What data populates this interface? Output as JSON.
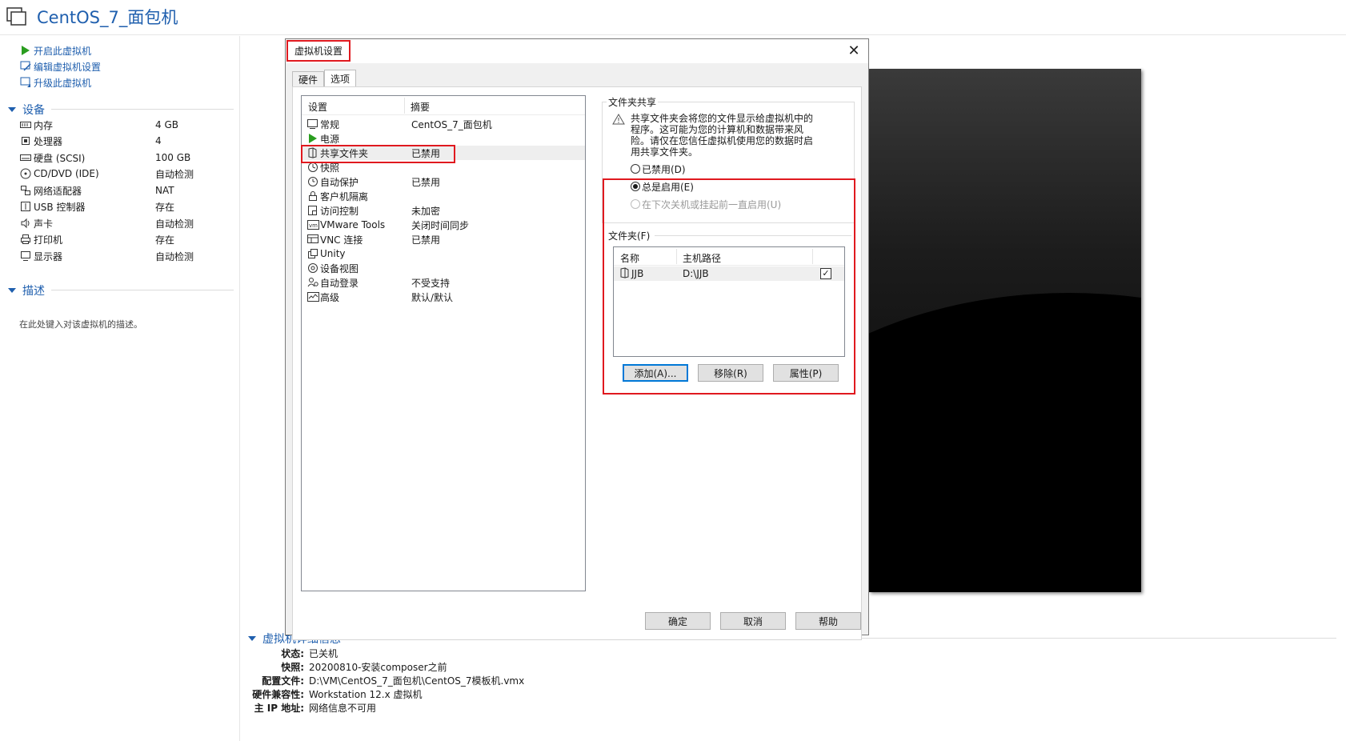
{
  "window": {
    "title": "CentOS_7_面包机"
  },
  "commands": [
    {
      "label": "开启此虚拟机",
      "icon": "play-icon"
    },
    {
      "label": "编辑虚拟机设置",
      "icon": "edit-settings-icon"
    },
    {
      "label": "升级此虚拟机",
      "icon": "upgrade-icon"
    }
  ],
  "devices": {
    "heading": "设备",
    "items": [
      {
        "name": "内存",
        "value": "4 GB",
        "icon": "memory-icon"
      },
      {
        "name": "处理器",
        "value": "4",
        "icon": "cpu-icon"
      },
      {
        "name": "硬盘 (SCSI)",
        "value": "100 GB",
        "icon": "hard-disk-icon"
      },
      {
        "name": "CD/DVD (IDE)",
        "value": "自动检测",
        "icon": "cd-icon"
      },
      {
        "name": "网络适配器",
        "value": "NAT",
        "icon": "network-icon"
      },
      {
        "name": "USB 控制器",
        "value": "存在",
        "icon": "usb-icon"
      },
      {
        "name": "声卡",
        "value": "自动检测",
        "icon": "sound-icon"
      },
      {
        "name": "打印机",
        "value": "存在",
        "icon": "printer-icon"
      },
      {
        "name": "显示器",
        "value": "自动检测",
        "icon": "display-icon"
      }
    ]
  },
  "description": {
    "heading": "描述",
    "placeholder": "在此处键入对该虚拟机的描述。"
  },
  "details": {
    "heading": "虚拟机详细信息",
    "rows": [
      {
        "key": "状态:",
        "value": "已关机"
      },
      {
        "key": "快照:",
        "value": "20200810-安装composer之前"
      },
      {
        "key": "配置文件:",
        "value": "D:\\VM\\CentOS_7_面包机\\CentOS_7模板机.vmx"
      },
      {
        "key": "硬件兼容性:",
        "value": "Workstation 12.x 虚拟机"
      },
      {
        "key": "主 IP 地址:",
        "value": "网络信息不可用"
      }
    ]
  },
  "dialog": {
    "title": "虚拟机设置",
    "close": "✕",
    "tabs": [
      {
        "label": "硬件",
        "active": false
      },
      {
        "label": "选项",
        "active": true
      }
    ],
    "settings_header": {
      "setting": "设置",
      "summary": "摘要"
    },
    "settings": [
      {
        "name": "常规",
        "summary": "CentOS_7_面包机",
        "icon": "general-icon"
      },
      {
        "name": "电源",
        "summary": "",
        "icon": "power-icon"
      },
      {
        "name": "共享文件夹",
        "summary": "已禁用",
        "icon": "shared-folder-icon",
        "selected": true
      },
      {
        "name": "快照",
        "summary": "",
        "icon": "snapshot-icon"
      },
      {
        "name": "自动保护",
        "summary": "已禁用",
        "icon": "autoprotect-icon"
      },
      {
        "name": "客户机隔离",
        "summary": "",
        "icon": "lock-icon"
      },
      {
        "name": "访问控制",
        "summary": "未加密",
        "icon": "access-control-icon"
      },
      {
        "name": "VMware Tools",
        "summary": "关闭时间同步",
        "icon": "vmware-tools-icon"
      },
      {
        "name": "VNC 连接",
        "summary": "已禁用",
        "icon": "vnc-icon"
      },
      {
        "name": "Unity",
        "summary": "",
        "icon": "unity-icon"
      },
      {
        "name": "设备视图",
        "summary": "",
        "icon": "device-view-icon"
      },
      {
        "name": "自动登录",
        "summary": "不受支持",
        "icon": "autologin-icon"
      },
      {
        "name": "高级",
        "summary": "默认/默认",
        "icon": "advanced-icon"
      }
    ],
    "sharing": {
      "group_label": "文件夹共享",
      "warning": "共享文件夹会将您的文件显示给虚拟机中的程序。这可能为您的计算机和数据带来风险。请仅在您信任虚拟机使用您的数据时启用共享文件夹。",
      "options": [
        {
          "label": "已禁用(D)",
          "checked": false,
          "disabled": false
        },
        {
          "label": "总是启用(E)",
          "checked": true,
          "disabled": false
        },
        {
          "label": "在下次关机或挂起前一直启用(U)",
          "checked": false,
          "disabled": true
        }
      ]
    },
    "folders": {
      "label": "文件夹(F)",
      "columns": {
        "name": "名称",
        "path": "主机路径"
      },
      "rows": [
        {
          "name": "JJB",
          "path": "D:\\JJB",
          "enabled": true
        }
      ],
      "add": "添加(A)...",
      "remove": "移除(R)",
      "properties": "属性(P)"
    },
    "buttons": {
      "ok": "确定",
      "cancel": "取消",
      "help": "帮助"
    }
  },
  "colors": {
    "accent": "#1f5fae",
    "highlight": "#e0191f",
    "focus": "#0078d7"
  }
}
